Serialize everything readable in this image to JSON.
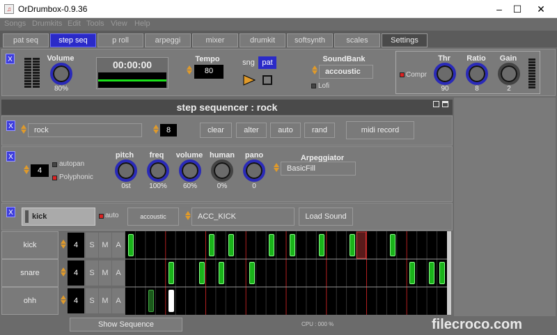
{
  "window": {
    "title": "OrDrumbox-0.9.36",
    "min": "–",
    "max": "☐",
    "close": "✕"
  },
  "menu": [
    "Songs",
    "Drumkits",
    "Edit",
    "Tools",
    "View",
    "Help"
  ],
  "tabs": [
    {
      "label": "pat seq",
      "active": false
    },
    {
      "label": "step seq",
      "active": true
    },
    {
      "label": "p roll",
      "active": false
    },
    {
      "label": "arpeggi",
      "active": false
    },
    {
      "label": "mixer",
      "active": false
    },
    {
      "label": "drumkit",
      "active": false
    },
    {
      "label": "softsynth",
      "active": false
    },
    {
      "label": "scales",
      "active": false
    },
    {
      "label": "Settings",
      "active": false
    }
  ],
  "top": {
    "close": "X",
    "volume_label": "Volume",
    "volume_value": "80%",
    "time": "00:00:00",
    "tempo_label": "Tempo",
    "tempo_value": "80",
    "sng": "sng",
    "pat": "pat",
    "soundbank_label": "SoundBank",
    "soundbank_value": "accoustic",
    "lofi": "Lofi",
    "compr": "Compr",
    "thr_label": "Thr",
    "thr_value": "90",
    "ratio_label": "Ratio",
    "ratio_value": "8",
    "gain_label": "Gain",
    "gain_value": "2"
  },
  "stepseq": {
    "title": "step sequencer : rock",
    "pattern_close": "X",
    "pattern_name": "rock",
    "steps": "8",
    "buttons": {
      "clear": "clear",
      "alter": "alter",
      "auto": "auto",
      "rand": "rand",
      "midi": "midi record"
    }
  },
  "params": {
    "close": "X",
    "voices": "4",
    "autopan": "autopan",
    "polyphonic": "Polyphonic",
    "knobs": [
      {
        "label": "pitch",
        "value": "0st"
      },
      {
        "label": "freq",
        "value": "100%"
      },
      {
        "label": "volume",
        "value": "60%"
      },
      {
        "label": "human",
        "value": "0%"
      },
      {
        "label": "pano",
        "value": "0"
      }
    ],
    "arp_label": "Arpeggiator",
    "arp_value": "BasicFill"
  },
  "instrument": {
    "close": "X",
    "name": "kick",
    "auto": "auto",
    "bank": "accoustic",
    "sample": "ACC_KICK",
    "load": "Load Sound"
  },
  "tracks": [
    {
      "name": "kick",
      "vel": "4",
      "s": "S",
      "m": "M",
      "a": "A"
    },
    {
      "name": "snare",
      "vel": "4",
      "s": "S",
      "m": "M",
      "a": "A"
    },
    {
      "name": "ohh",
      "vel": "4",
      "s": "S",
      "m": "M",
      "a": "A"
    }
  ],
  "footer": {
    "show_sequence": "Show Sequence",
    "cpu": "CPU : 000 %"
  },
  "watermark": "filecroco.com",
  "colors": {
    "accent": "#2a2ac8",
    "step_on": "#1ab31a",
    "beat_line": "#b52020"
  }
}
